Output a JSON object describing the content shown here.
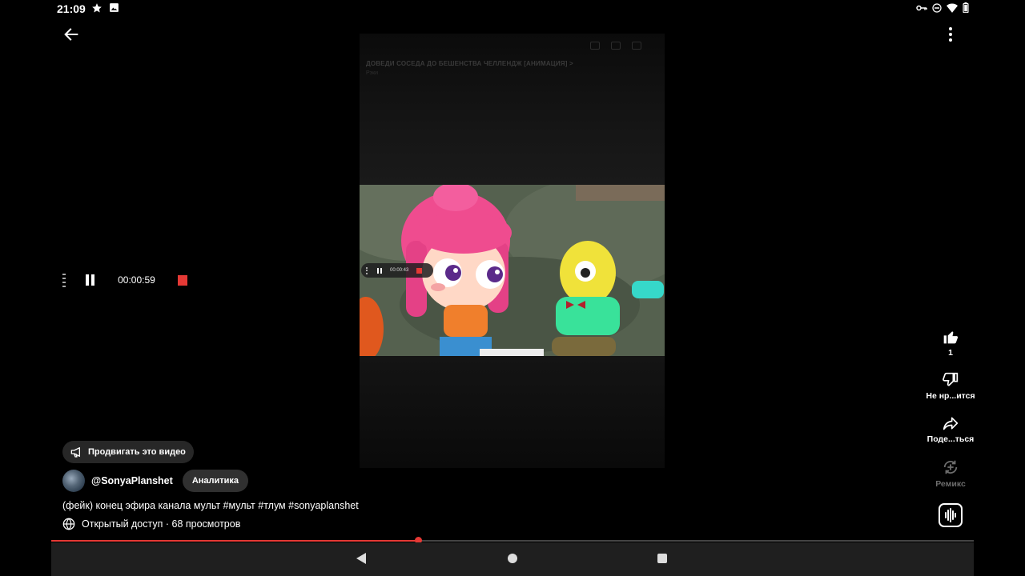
{
  "status_bar": {
    "time": "21:09",
    "left_icons": [
      "star-icon",
      "image-icon"
    ],
    "right_icons": [
      "key-icon",
      "do-not-disturb-icon",
      "wifi-icon",
      "battery-icon"
    ]
  },
  "header": {
    "back_icon": "arrow-left-icon",
    "more_icon": "more-vertical-icon"
  },
  "video": {
    "ghost_title": "ДОВЕДИ СОСЕДА ДО БЕШЕНСТВА ЧЕЛЛЕНДЖ [АНИМАЦИЯ] >",
    "ghost_subtitle": "Рэки",
    "mini_recorder_time": "00:00:43"
  },
  "recorder": {
    "time": "00:00:59",
    "stop_color": "#e53935"
  },
  "actions": {
    "like_count": "1",
    "dislike_label": "Не нр...ится",
    "share_label": "Поде...ться",
    "remix_label": "Ремикс"
  },
  "info": {
    "promote_label": "Продвигать это видео",
    "channel_name": "@SonyaPlanshet",
    "analytics_label": "Аналитика",
    "description": "(фейк) конец эфира канала мульт #мульт #тлум #sonyaplanshet",
    "visibility_meta": "Открытый доступ · 68 просмотров"
  },
  "progress": {
    "played_fraction": 0.398,
    "color": "#e53935"
  },
  "navbar": {
    "icons": [
      "nav-back-icon",
      "nav-home-icon",
      "nav-recents-icon"
    ]
  }
}
